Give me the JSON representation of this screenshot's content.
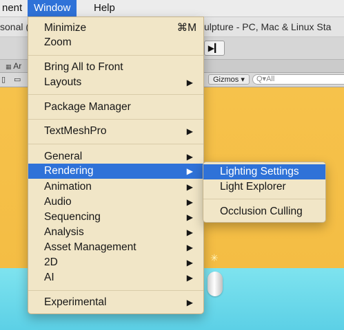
{
  "menubar": {
    "items": [
      {
        "label": "nent"
      },
      {
        "label": "Window"
      },
      {
        "label": "Help"
      }
    ]
  },
  "titlebar": {
    "left_text": "sonal (",
    "right_text": "ulpture - PC, Mac & Linux Sta"
  },
  "toolbar": {
    "step_icon": "step-forward-icon",
    "step_glyph": "▶▎"
  },
  "tabbar": {
    "partial_label": "Ar"
  },
  "scene_toolbar": {
    "gizmos_label": "Gizmos",
    "gizmos_caret": "▾",
    "search_text": "Q▾All"
  },
  "window_menu": {
    "items": [
      {
        "label": "Minimize",
        "shortcut": "⌘M",
        "submenu": false
      },
      {
        "label": "Zoom",
        "submenu": false
      },
      {
        "label": "Bring All to Front",
        "submenu": false
      },
      {
        "label": "Layouts",
        "submenu": true
      },
      {
        "label": "Package Manager",
        "submenu": false
      },
      {
        "label": "TextMeshPro",
        "submenu": true
      },
      {
        "label": "General",
        "submenu": true
      },
      {
        "label": "Rendering",
        "submenu": true,
        "highlighted": true
      },
      {
        "label": "Animation",
        "submenu": true
      },
      {
        "label": "Audio",
        "submenu": true
      },
      {
        "label": "Sequencing",
        "submenu": true
      },
      {
        "label": "Analysis",
        "submenu": true
      },
      {
        "label": "Asset Management",
        "submenu": true
      },
      {
        "label": "2D",
        "submenu": true
      },
      {
        "label": "AI",
        "submenu": true
      },
      {
        "label": "Experimental",
        "submenu": true
      }
    ],
    "arrow_glyph": "▶"
  },
  "rendering_submenu": {
    "items": [
      {
        "label": "Lighting Settings",
        "highlighted": true
      },
      {
        "label": "Light Explorer"
      },
      {
        "label": "Occlusion Culling"
      }
    ]
  },
  "colors": {
    "menu_bg": "#f1e6c7",
    "highlight": "#2f72d8",
    "sky": "#f5c24a",
    "floor": "#6fdcea"
  }
}
